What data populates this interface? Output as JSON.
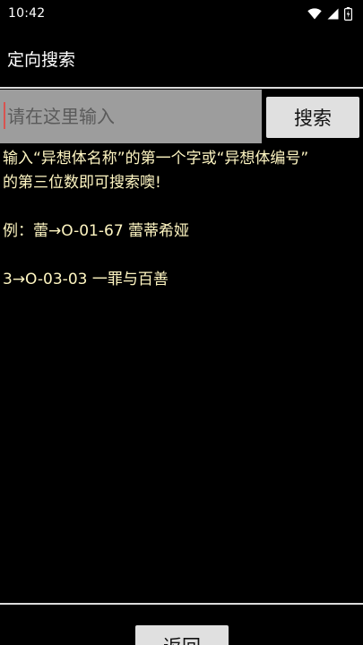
{
  "status_bar": {
    "time": "10:42",
    "icons": [
      "wifi-icon",
      "signal-icon",
      "battery-icon"
    ]
  },
  "app_bar": {
    "title": "定向搜索"
  },
  "search": {
    "placeholder": "请在这里输入",
    "value": "",
    "button_label": "搜索"
  },
  "help": {
    "line1": "输入“异想体名称”的第一个字或“异想体编号”",
    "line2": "的第三位数即可搜索噢!",
    "example1": "例：蕾→O-01-67 蕾蒂希娅",
    "example2": "3→O-03-03 一罪与百善"
  },
  "footer": {
    "back_label": "返回"
  },
  "colors": {
    "background": "#000000",
    "help_text": "#fff6c2",
    "input_bg": "#9d9d9d",
    "button_bg": "#e0e0e0",
    "caret": "#d9534f"
  }
}
